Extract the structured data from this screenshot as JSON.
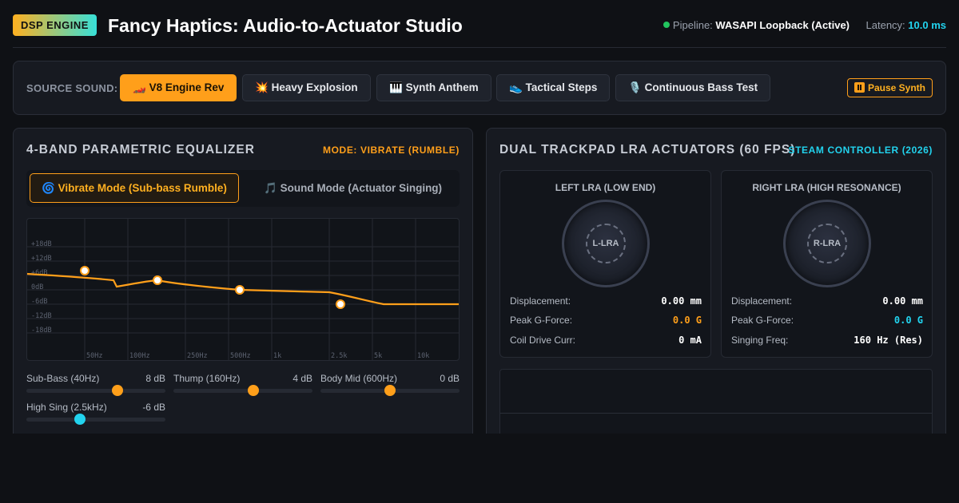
{
  "header": {
    "badge": "DSP ENGINE",
    "title": "Fancy Haptics: Audio-to-Actuator Studio",
    "pipeline_label": "Pipeline:",
    "pipeline_value": "WASAPI Loopback (Active)",
    "latency_label": "Latency:",
    "latency_value": "10.0 ms"
  },
  "source": {
    "label": "SOURCE SOUND:",
    "buttons": [
      {
        "icon": "🏎️",
        "label": "V8 Engine Rev",
        "active": true
      },
      {
        "icon": "💥",
        "label": "Heavy Explosion",
        "active": false
      },
      {
        "icon": "🎹",
        "label": "Synth Anthem",
        "active": false
      },
      {
        "icon": "👟",
        "label": "Tactical Steps",
        "active": false
      },
      {
        "icon": "🎙️",
        "label": "Continuous Bass Test",
        "active": false
      }
    ],
    "pause_label": "Pause Synth"
  },
  "equalizer": {
    "title": "4-BAND PARAMETRIC EQUALIZER",
    "mode_tag": "MODE: VIBRATE (RUMBLE)",
    "modes": [
      {
        "icon": "🌀",
        "label": "Vibrate Mode (Sub-bass Rumble)",
        "active": true
      },
      {
        "icon": "🎵",
        "label": "Sound Mode (Actuator Singing)",
        "active": false
      }
    ],
    "db_ticks": [
      "+18dB",
      "+12dB",
      "+6dB",
      "0dB",
      "-6dB",
      "-12dB",
      "-18dB"
    ],
    "freq_ticks": [
      "50Hz",
      "100Hz",
      "250Hz",
      "500Hz",
      "1k",
      "2.5k",
      "5k",
      "10k"
    ],
    "bands": [
      {
        "label": "Sub-Bass (40Hz)",
        "value": "8 dB",
        "gain": 8,
        "color": "#ff9f1a"
      },
      {
        "label": "Thump (160Hz)",
        "value": "4 dB",
        "gain": 4,
        "color": "#ff9f1a"
      },
      {
        "label": "Body Mid (600Hz)",
        "value": "0 dB",
        "gain": 0,
        "color": "#ff9f1a"
      },
      {
        "label": "High Sing (2.5kHz)",
        "value": "-6 dB",
        "gain": -6,
        "color": "#22d3ee"
      }
    ]
  },
  "actuators": {
    "title": "DUAL TRACKPAD LRA ACTUATORS (60 FPS)",
    "tag": "STEAM CONTROLLER (2026)",
    "left": {
      "title": "LEFT LRA (LOW END)",
      "knob": "L-LRA",
      "displacement_label": "Displacement:",
      "displacement": "0.00 mm",
      "gforce_label": "Peak G-Force:",
      "gforce": "0.0 G",
      "extra_label": "Coil Drive Curr:",
      "extra": "0 mA"
    },
    "right": {
      "title": "RIGHT LRA (HIGH RESONANCE)",
      "knob": "R-LRA",
      "displacement_label": "Displacement:",
      "displacement": "0.00 mm",
      "gforce_label": "Peak G-Force:",
      "gforce": "0.0 G",
      "extra_label": "Singing Freq:",
      "extra": "160 Hz (Res)"
    }
  },
  "colors": {
    "accent_orange": "#ff9f1a",
    "accent_cyan": "#22d3ee",
    "status_green": "#22c55e"
  }
}
